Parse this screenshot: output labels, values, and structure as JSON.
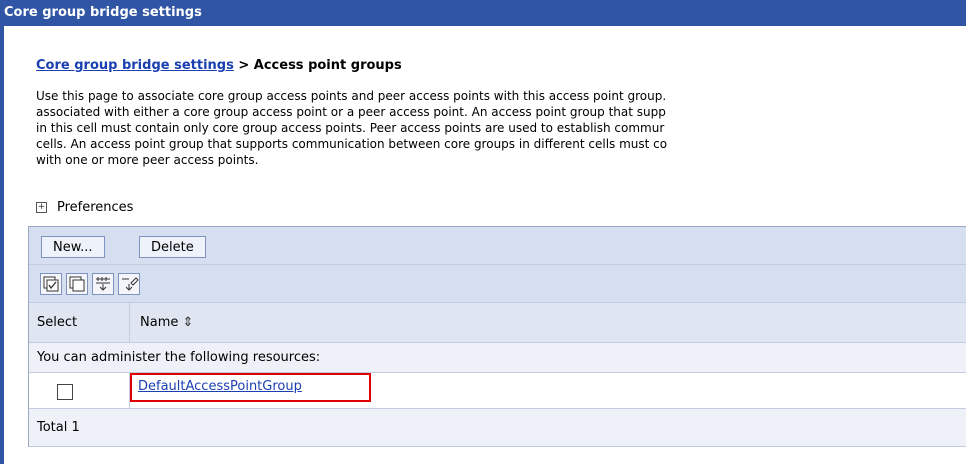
{
  "window": {
    "title": "Core group bridge settings"
  },
  "breadcrumb": {
    "link": "Core group bridge settings",
    "separator": " > ",
    "current": "Access point groups"
  },
  "description": {
    "lines": [
      "Use this page to associate core group access points and peer access points with this access point group.",
      "associated with either a core group access point or a peer access point. An access point group that supp",
      "in this cell must contain only core group access points. Peer access points are used to establish commur",
      "cells. An access point group that supports communication between core groups in different cells must co",
      "with one or more peer access points."
    ]
  },
  "preferences": {
    "toggle": "+",
    "label": "Preferences"
  },
  "toolbar": {
    "new_label": "New...",
    "delete_label": "Delete"
  },
  "icons": [
    "select-all-icon",
    "deselect-all-icon",
    "show-filter-icon",
    "clear-filter-icon"
  ],
  "table": {
    "columns": [
      "Select",
      "Name"
    ],
    "sort_glyph": "⇕",
    "admin_message": "You can administer the following resources:",
    "rows": [
      {
        "name": "DefaultAccessPointGroup",
        "selected": false
      }
    ],
    "total": "Total 1"
  },
  "colors": {
    "title_bar": "#2f55a4",
    "link": "#1a3fb0",
    "highlight": "#e00000"
  }
}
